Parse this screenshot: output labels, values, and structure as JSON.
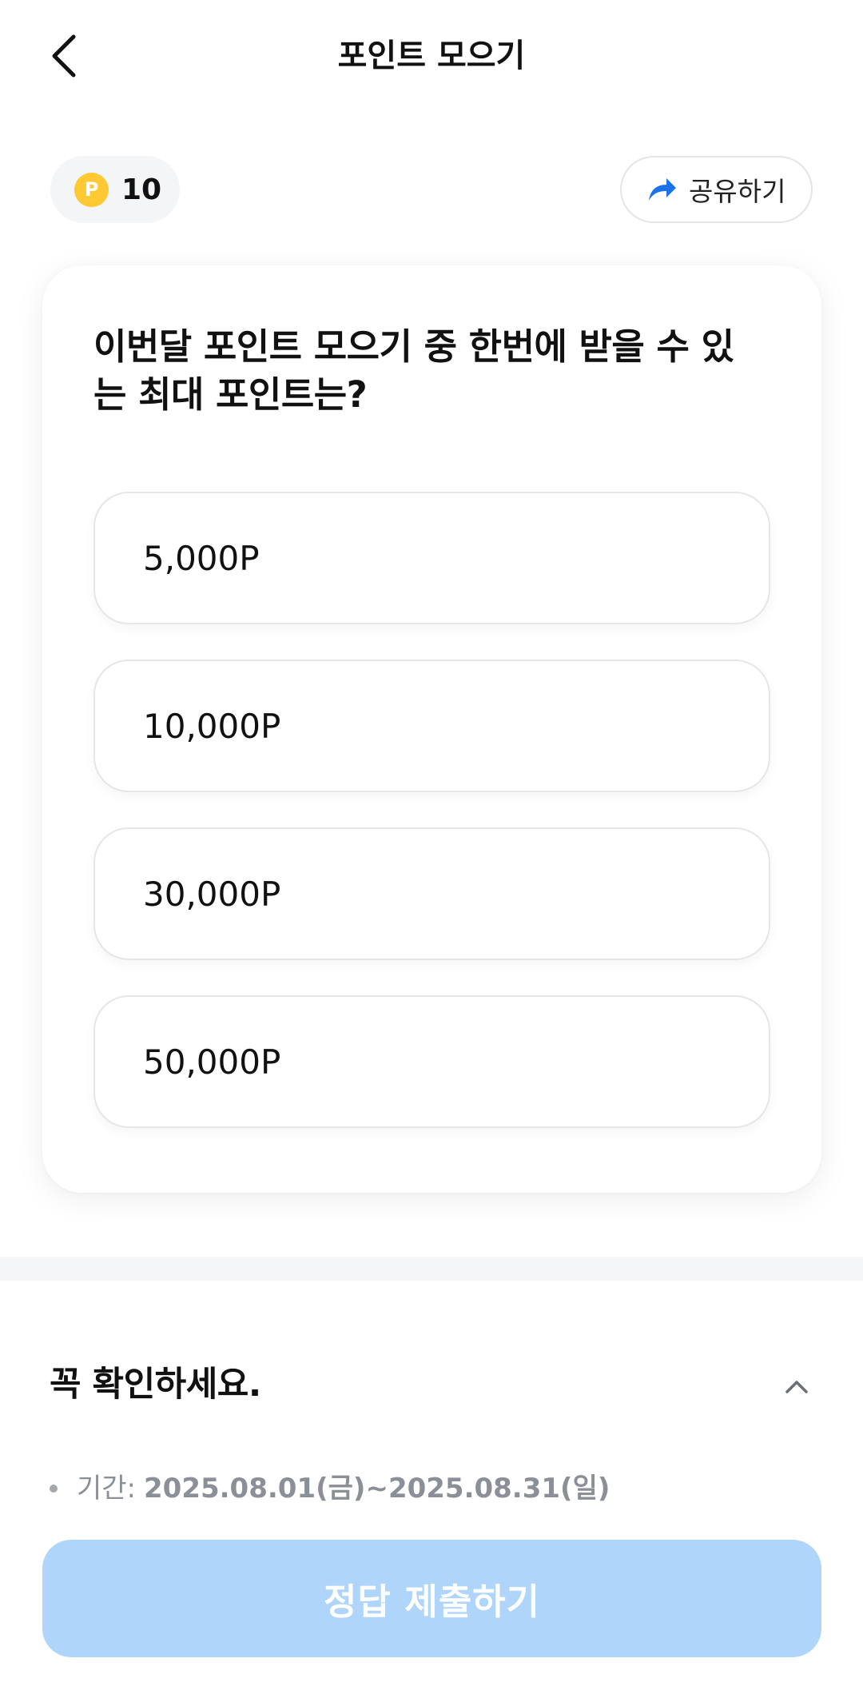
{
  "header": {
    "title": "포인트 모으기",
    "back_icon": "chevron-left-icon"
  },
  "points": {
    "coin_symbol": "P",
    "value": "10",
    "coin_color": "#ffc933"
  },
  "share": {
    "label": "공유하기",
    "icon": "share-arrow-icon",
    "icon_color": "#1a73e8"
  },
  "quiz": {
    "question": "이번달 포인트 모으기 중 한번에 받을 수 있는 최대 포인트는?",
    "options": [
      {
        "label": "5,000P"
      },
      {
        "label": "10,000P"
      },
      {
        "label": "30,000P"
      },
      {
        "label": "50,000P"
      }
    ]
  },
  "notice": {
    "title": "꼭 확인하세요.",
    "toggle_icon": "chevron-up-icon",
    "items": [
      {
        "label": "기간:",
        "value": "2025.08.01(금)~2025.08.31(일)"
      }
    ]
  },
  "submit": {
    "label": "정답 제출하기",
    "background_color": "#b0d5fb",
    "state": "disabled"
  }
}
